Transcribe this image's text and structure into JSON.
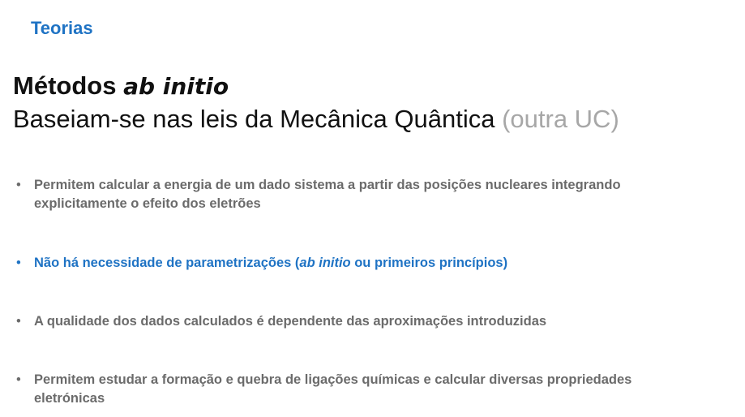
{
  "header": {
    "section_label": "Teorias"
  },
  "title": {
    "bold_part": "Métodos ",
    "italic_part": "ab initio"
  },
  "subtitle": {
    "main": "Baseiam-se nas leis da Mecânica Quântica ",
    "muted": "(outra UC)"
  },
  "bullets": [
    {
      "marker": "•",
      "text": "Permitem calcular a energia de um dado sistema a partir das posições nucleares integrando explicitamente  o efeito dos eletrões"
    },
    {
      "marker": "•",
      "text_before": "Não há necessidade de parametrizações (",
      "text_italic": "ab initio",
      "text_after": " ou primeiros princípios)"
    },
    {
      "marker": "•",
      "text": "A qualidade dos dados calculados é dependente das aproximações introduzidas"
    },
    {
      "marker": "•",
      "text": "Permitem estudar a formação e quebra de ligações químicas e calcular diversas propriedades eletrónicas"
    }
  ],
  "colors": {
    "accent_blue": "#1f73c4",
    "body_gray": "#6b6b6b",
    "muted_gray": "#a7a7a7"
  }
}
